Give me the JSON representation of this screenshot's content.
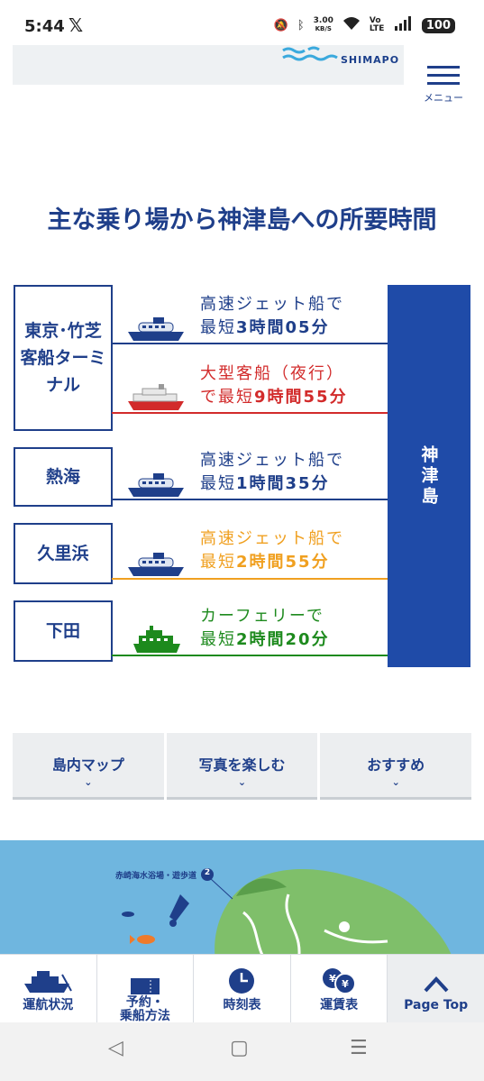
{
  "status": {
    "time": "5:44",
    "x_icon": "x-logo-icon",
    "speed": "3.00",
    "speed_unit": "KB/S",
    "volte": "Vo LTE",
    "battery": "100"
  },
  "header": {
    "logo": "SHIMAPO",
    "menu_label": "メニュー"
  },
  "title": "主な乗り場から神津島への所要時間",
  "destination": "神津島",
  "origins": [
    {
      "name": "東京･竹芝客船ターミナル"
    },
    {
      "name": "熱海"
    },
    {
      "name": "久里浜"
    },
    {
      "name": "下田"
    }
  ],
  "routes": [
    {
      "line1": "高速ジェット船で",
      "line2_pre": "最短",
      "line2_bold": "3時間05分",
      "color": "#1f3f8a",
      "ship": "jet-boat-icon"
    },
    {
      "line1": "大型客船（夜行）",
      "line2_pre": "で最短",
      "line2_bold": "9時間55分",
      "color": "#d22b2b",
      "ship": "large-ship-icon"
    },
    {
      "line1": "高速ジェット船で",
      "line2_pre": "最短",
      "line2_bold": "1時間35分",
      "color": "#1f3f8a",
      "ship": "jet-boat-icon"
    },
    {
      "line1": "高速ジェット船で",
      "line2_pre": "最短",
      "line2_bold": "2時間55分",
      "color": "#f0a020",
      "ship": "jet-boat-icon"
    },
    {
      "line1": "カーフェリーで",
      "line2_pre": "最短",
      "line2_bold": "2時間20分",
      "color": "#1d8a1d",
      "ship": "car-ferry-icon"
    }
  ],
  "tabs": [
    {
      "label": "島内マップ"
    },
    {
      "label": "写真を楽しむ"
    },
    {
      "label": "おすすめ"
    }
  ],
  "map": {
    "label": "赤崎海水浴場・遊歩道",
    "badge": "2"
  },
  "bottom_nav": [
    {
      "label": "運航状況",
      "icon": "ship-icon"
    },
    {
      "label": "予約・\n乗船方法",
      "icon": "ticket-icon"
    },
    {
      "label": "時刻表",
      "icon": "clock-icon"
    },
    {
      "label": "運賃表",
      "icon": "yen-coins-icon"
    },
    {
      "label": "Page Top",
      "icon": "chevron-up-icon"
    }
  ]
}
